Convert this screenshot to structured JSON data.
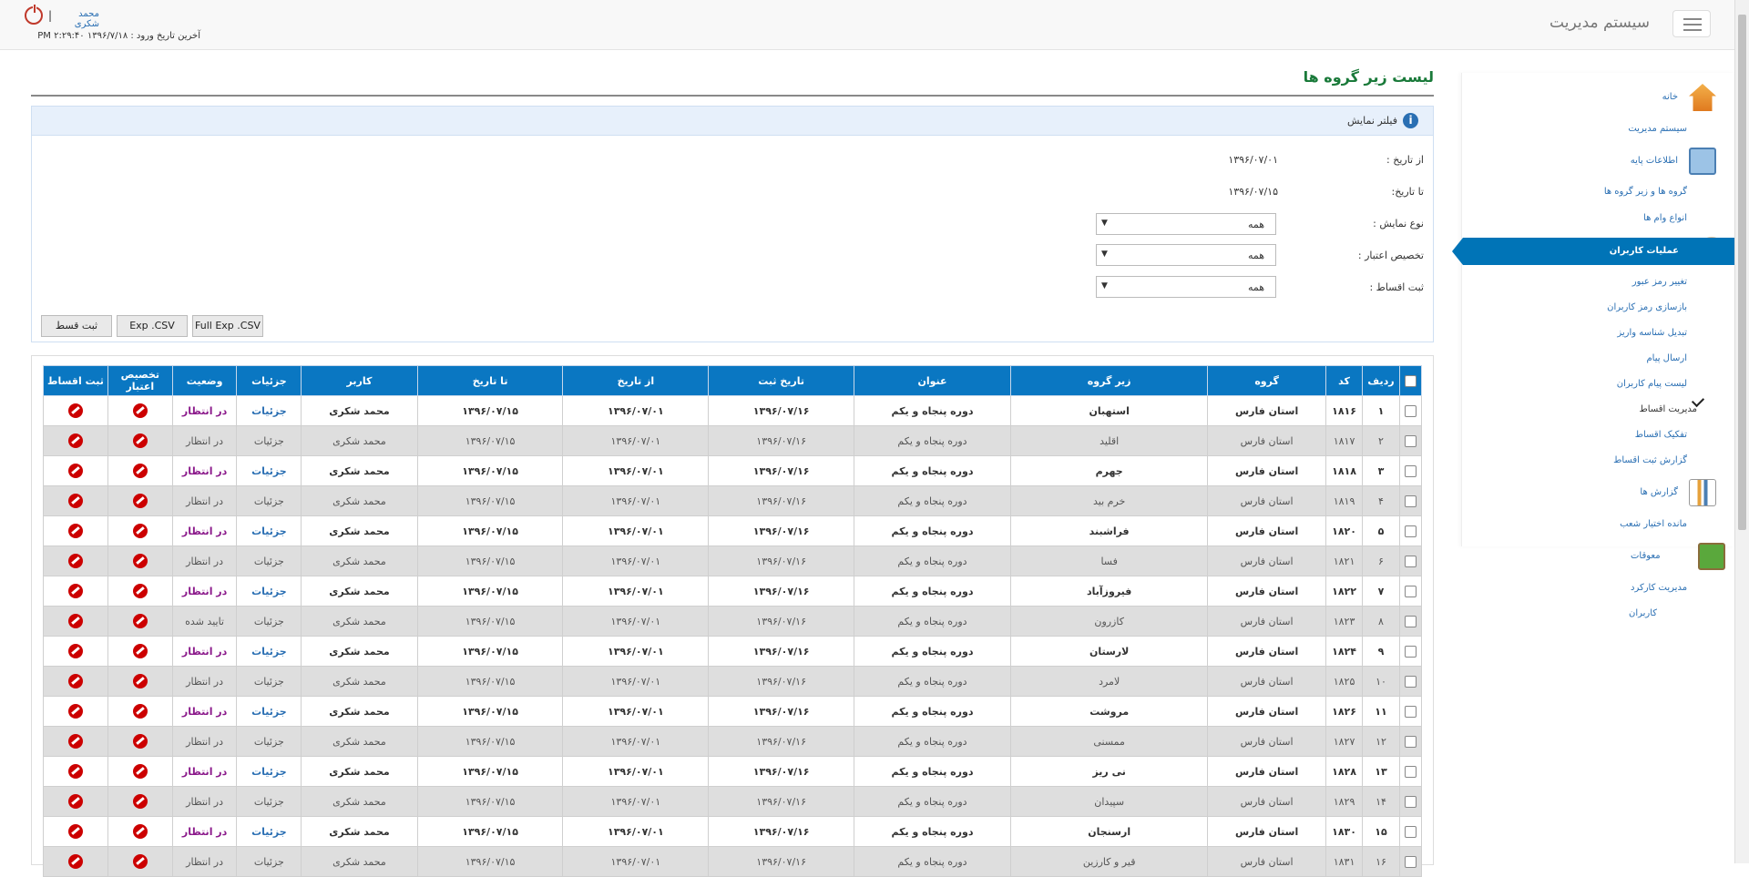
{
  "header": {
    "brand": "سیستم مدیریت",
    "user": "محمد شکری",
    "separator": "|",
    "last_login": "آخرین تاریخ ورود : ۱۳۹۶/۷/۱۸ ۲:۲۹:۴۰ PM"
  },
  "sidebar": {
    "home": "خانه",
    "system_admin": "سیستم مدیریت",
    "base_info": "اطلاعات پایه",
    "groups": "گروه ها و زیر گروه ها",
    "loan_types": "انواع وام ها",
    "user_ops": "عملیات کاربران",
    "change_password": "تغییر رمز عبور",
    "reset_password": "بازسازی رمز کاربران",
    "convert_deposit": "تبدیل شناسه واریز",
    "send_message": "ارسال پیام",
    "user_messages": "لیست پیام کاربران",
    "installments": "مدیریت اقساط",
    "split_installments": "تفکیک اقساط",
    "installment_report": "گزارش ثبت اقساط",
    "reports": "گزارش ها",
    "branch_credit": "مانده اختیار شعب",
    "claims": "معوقات",
    "performance": "مدیریت کارکرد",
    "users": "کاربران"
  },
  "page": {
    "title": "لیست زیر گروه ها"
  },
  "filter": {
    "title": "فیلتر نمایش",
    "from_label": "از تاریخ :",
    "from_value": "۱۳۹۶/۰۷/۰۱",
    "to_label": "تا تاریخ:",
    "to_value": "۱۳۹۶/۰۷/۱۵",
    "display_label": "نوع نمایش :",
    "display_value": "همه",
    "credit_label": "تخصیص اعتبار :",
    "credit_value": "همه",
    "install_label": "ثبت اقساط :",
    "install_value": "همه",
    "btn_submit": "ثبت قسط",
    "btn_csv": "Exp .CSV",
    "btn_full_csv": "Full Exp .CSV"
  },
  "table": {
    "headers": {
      "row": "ردیف",
      "code": "کد",
      "group": "گروه",
      "subgroup": "زیر گروه",
      "title": "عنوان",
      "reg_date": "تاریخ ثبت",
      "from": "از تاریخ",
      "to": "تا تاریخ",
      "user": "کاربر",
      "details": "جزئیات",
      "status": "وضعیت",
      "credit": "تخصیص اعتبار",
      "install": "ثبت اقساط"
    },
    "rows": [
      {
        "row": "۱",
        "code": "۱۸۱۶",
        "group": "استان فارس",
        "subgroup": "استهبان",
        "title": "دوره پنجاه و یکم",
        "reg": "۱۳۹۶/۰۷/۱۶",
        "from": "۱۳۹۶/۰۷/۰۱",
        "to": "۱۳۹۶/۰۷/۱۵",
        "user": "محمد شکری",
        "details": "جزئیات",
        "status": "در انتظار"
      },
      {
        "row": "۲",
        "code": "۱۸۱۷",
        "group": "استان فارس",
        "subgroup": "اقلید",
        "title": "دوره پنجاه و یکم",
        "reg": "۱۳۹۶/۰۷/۱۶",
        "from": "۱۳۹۶/۰۷/۰۱",
        "to": "۱۳۹۶/۰۷/۱۵",
        "user": "محمد شکری",
        "details": "جزئیات",
        "status": "در انتظار"
      },
      {
        "row": "۳",
        "code": "۱۸۱۸",
        "group": "استان فارس",
        "subgroup": "جهرم",
        "title": "دوره پنجاه و یکم",
        "reg": "۱۳۹۶/۰۷/۱۶",
        "from": "۱۳۹۶/۰۷/۰۱",
        "to": "۱۳۹۶/۰۷/۱۵",
        "user": "محمد شکری",
        "details": "جزئیات",
        "status": "در انتظار"
      },
      {
        "row": "۴",
        "code": "۱۸۱۹",
        "group": "استان فارس",
        "subgroup": "خرم بید",
        "title": "دوره پنجاه و یکم",
        "reg": "۱۳۹۶/۰۷/۱۶",
        "from": "۱۳۹۶/۰۷/۰۱",
        "to": "۱۳۹۶/۰۷/۱۵",
        "user": "محمد شکری",
        "details": "جزئیات",
        "status": "در انتظار"
      },
      {
        "row": "۵",
        "code": "۱۸۲۰",
        "group": "استان فارس",
        "subgroup": "فراشبند",
        "title": "دوره پنجاه و یکم",
        "reg": "۱۳۹۶/۰۷/۱۶",
        "from": "۱۳۹۶/۰۷/۰۱",
        "to": "۱۳۹۶/۰۷/۱۵",
        "user": "محمد شکری",
        "details": "جزئیات",
        "status": "در انتظار"
      },
      {
        "row": "۶",
        "code": "۱۸۲۱",
        "group": "استان فارس",
        "subgroup": "فسا",
        "title": "دوره پنجاه و یکم",
        "reg": "۱۳۹۶/۰۷/۱۶",
        "from": "۱۳۹۶/۰۷/۰۱",
        "to": "۱۳۹۶/۰۷/۱۵",
        "user": "محمد شکری",
        "details": "جزئیات",
        "status": "در انتظار"
      },
      {
        "row": "۷",
        "code": "۱۸۲۲",
        "group": "استان فارس",
        "subgroup": "فیروزآباد",
        "title": "دوره پنجاه و یکم",
        "reg": "۱۳۹۶/۰۷/۱۶",
        "from": "۱۳۹۶/۰۷/۰۱",
        "to": "۱۳۹۶/۰۷/۱۵",
        "user": "محمد شکری",
        "details": "جزئیات",
        "status": "در انتظار"
      },
      {
        "row": "۸",
        "code": "۱۸۲۳",
        "group": "استان فارس",
        "subgroup": "کازرون",
        "title": "دوره پنجاه و یکم",
        "reg": "۱۳۹۶/۰۷/۱۶",
        "from": "۱۳۹۶/۰۷/۰۱",
        "to": "۱۳۹۶/۰۷/۱۵",
        "user": "محمد شکری",
        "details": "جزئیات",
        "status": "تایید شده"
      },
      {
        "row": "۹",
        "code": "۱۸۲۴",
        "group": "استان فارس",
        "subgroup": "لارستان",
        "title": "دوره پنجاه و یکم",
        "reg": "۱۳۹۶/۰۷/۱۶",
        "from": "۱۳۹۶/۰۷/۰۱",
        "to": "۱۳۹۶/۰۷/۱۵",
        "user": "محمد شکری",
        "details": "جزئیات",
        "status": "در انتظار"
      },
      {
        "row": "۱۰",
        "code": "۱۸۲۵",
        "group": "استان فارس",
        "subgroup": "لامرد",
        "title": "دوره پنجاه و یکم",
        "reg": "۱۳۹۶/۰۷/۱۶",
        "from": "۱۳۹۶/۰۷/۰۱",
        "to": "۱۳۹۶/۰۷/۱۵",
        "user": "محمد شکری",
        "details": "جزئیات",
        "status": "در انتظار"
      },
      {
        "row": "۱۱",
        "code": "۱۸۲۶",
        "group": "استان فارس",
        "subgroup": "مروشت",
        "title": "دوره پنجاه و یکم",
        "reg": "۱۳۹۶/۰۷/۱۶",
        "from": "۱۳۹۶/۰۷/۰۱",
        "to": "۱۳۹۶/۰۷/۱۵",
        "user": "محمد شکری",
        "details": "جزئیات",
        "status": "در انتظار"
      },
      {
        "row": "۱۲",
        "code": "۱۸۲۷",
        "group": "استان فارس",
        "subgroup": "ممسنی",
        "title": "دوره پنجاه و یکم",
        "reg": "۱۳۹۶/۰۷/۱۶",
        "from": "۱۳۹۶/۰۷/۰۱",
        "to": "۱۳۹۶/۰۷/۱۵",
        "user": "محمد شکری",
        "details": "جزئیات",
        "status": "در انتظار"
      },
      {
        "row": "۱۳",
        "code": "۱۸۲۸",
        "group": "استان فارس",
        "subgroup": "نی ریز",
        "title": "دوره پنجاه و یکم",
        "reg": "۱۳۹۶/۰۷/۱۶",
        "from": "۱۳۹۶/۰۷/۰۱",
        "to": "۱۳۹۶/۰۷/۱۵",
        "user": "محمد شکری",
        "details": "جزئیات",
        "status": "در انتظار"
      },
      {
        "row": "۱۴",
        "code": "۱۸۲۹",
        "group": "استان فارس",
        "subgroup": "سپیدان",
        "title": "دوره پنجاه و یکم",
        "reg": "۱۳۹۶/۰۷/۱۶",
        "from": "۱۳۹۶/۰۷/۰۱",
        "to": "۱۳۹۶/۰۷/۱۵",
        "user": "محمد شکری",
        "details": "جزئیات",
        "status": "در انتظار"
      },
      {
        "row": "۱۵",
        "code": "۱۸۳۰",
        "group": "استان فارس",
        "subgroup": "ارسنجان",
        "title": "دوره پنجاه و یکم",
        "reg": "۱۳۹۶/۰۷/۱۶",
        "from": "۱۳۹۶/۰۷/۰۱",
        "to": "۱۳۹۶/۰۷/۱۵",
        "user": "محمد شکری",
        "details": "جزئیات",
        "status": "در انتظار"
      },
      {
        "row": "۱۶",
        "code": "۱۸۳۱",
        "group": "استان فارس",
        "subgroup": "قیر و کارزین",
        "title": "دوره پنجاه و یکم",
        "reg": "۱۳۹۶/۰۷/۱۶",
        "from": "۱۳۹۶/۰۷/۰۱",
        "to": "۱۳۹۶/۰۷/۱۵",
        "user": "محمد شکری",
        "details": "جزئیات",
        "status": "در انتظار"
      }
    ]
  },
  "colors": {
    "accent": "#0074b7",
    "title": "#1a7a3a",
    "pending": "#8b1a8b",
    "approved": "#2e8b2e",
    "stop": "#cc0000"
  }
}
